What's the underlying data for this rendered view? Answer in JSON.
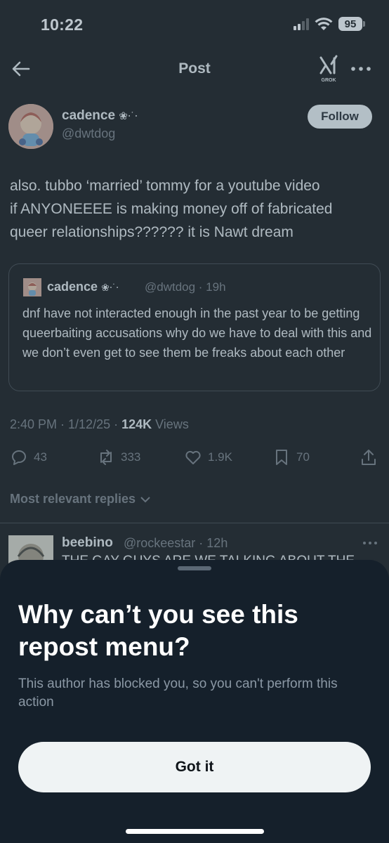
{
  "status_bar": {
    "time": "10:22",
    "battery": "95"
  },
  "nav": {
    "title": "Post",
    "grok_label": "GROK",
    "icons": [
      "back-arrow-icon",
      "grok-icon",
      "more-icon"
    ]
  },
  "post": {
    "display_name": "cadence",
    "name_emoji": "❀⋅˙⋅",
    "handle": "@dwtdog",
    "follow_label": "Follow",
    "text": "also. tubbo ‘married’ tommy for a youtube video\nif ANYONEEEE is making money off of fabricated\nqueer relationships?????? it is Nawt dream",
    "meta": {
      "time_date": "2:40 PM · 1/12/25 · ",
      "views_count": "124K",
      "views_label": " Views"
    },
    "actions": {
      "replies": "43",
      "reposts": "333",
      "likes": "1.9K",
      "bookmarks": "70"
    }
  },
  "quote": {
    "display_name": "cadence",
    "name_emoji": "❀⋅˙⋅",
    "handle_time": "@dwtdog · 19h",
    "text": "dnf have not interacted enough in the past year to be getting queerbaiting accusations why do we have to deal with this and we don’t even get to see them be freaks about each other"
  },
  "replies_section": {
    "sort_label": "Most relevant replies"
  },
  "reply": {
    "display_name": "beebino",
    "handle_time": "@rockeestar · 12h",
    "text": "THE GAY GUYS ARE WE TALKING ABOUT THE"
  },
  "sheet": {
    "title": "Why can’t you see this repost menu?",
    "body": "This author has blocked you, so you can't perform this action",
    "button_label": "Got it"
  },
  "colors": {
    "background": "#000000",
    "sheet_background": "#15202b",
    "secondary_text": "#71767b",
    "button_background": "#eff3f4"
  }
}
